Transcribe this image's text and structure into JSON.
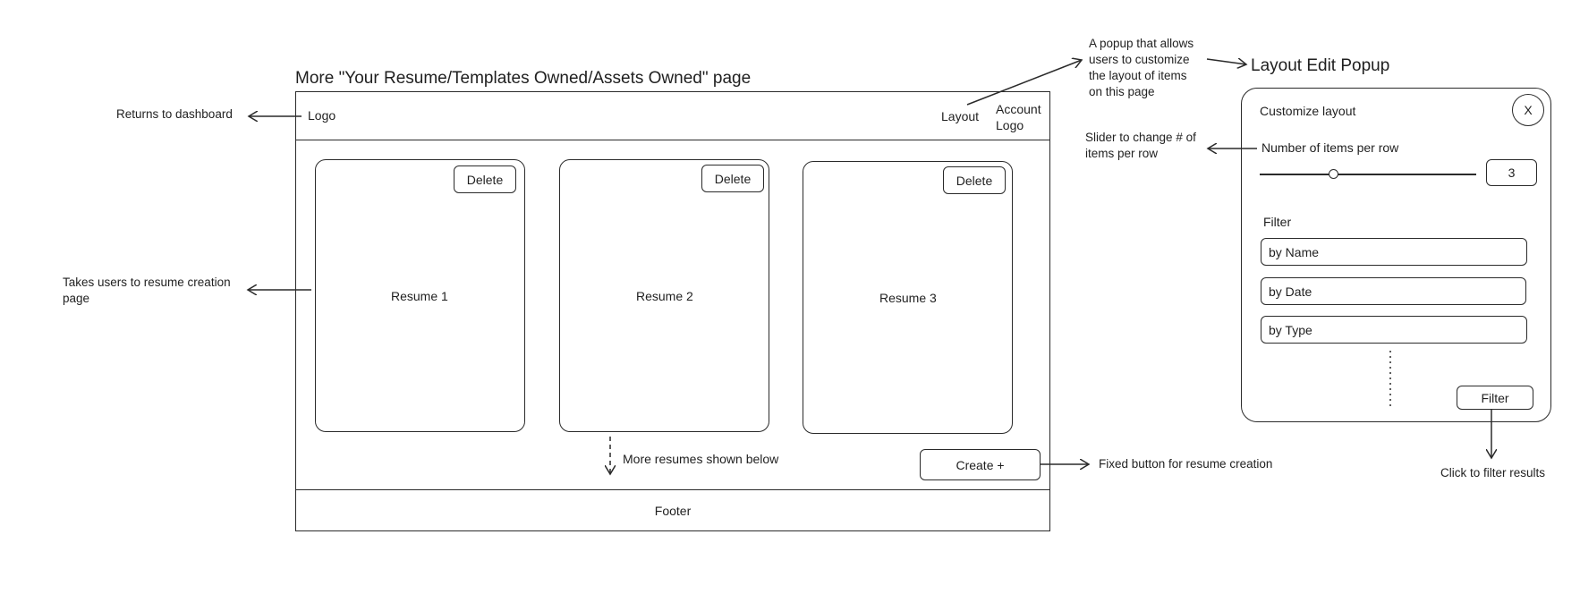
{
  "page_title": "More \"Your Resume/Templates Owned/Assets Owned\" page",
  "header": {
    "logo_label": "Logo",
    "layout_label": "Layout",
    "account_logo_line1": "Account",
    "account_logo_line2": "Logo"
  },
  "cards": [
    {
      "title": "Resume 1",
      "delete_label": "Delete"
    },
    {
      "title": "Resume 2",
      "delete_label": "Delete"
    },
    {
      "title": "Resume 3",
      "delete_label": "Delete"
    }
  ],
  "more_resumes_label": "More resumes shown below",
  "create_button_label": "Create +",
  "footer_label": "Footer",
  "annotations": {
    "returns_dashboard": "Returns to dashboard",
    "takes_to_creation_line1": "Takes users to resume creation",
    "takes_to_creation_line2": "page",
    "fixed_button": "Fixed button for resume creation",
    "popup_desc_line1": "A popup that allows",
    "popup_desc_line2": "users to customize",
    "popup_desc_line3": "the layout of items",
    "popup_desc_line4": "on this page",
    "slider_desc_line1": "Slider to change # of",
    "slider_desc_line2": "items per row",
    "filter_desc": "Click to filter results"
  },
  "popup": {
    "heading": "Layout Edit Popup",
    "title": "Customize layout",
    "close_label": "X",
    "items_per_row_label": "Number of items per row",
    "items_per_row_value": "3",
    "filter_heading": "Filter",
    "filter_options": [
      "by Name",
      "by Date",
      "by Type"
    ],
    "filter_button_label": "Filter"
  }
}
